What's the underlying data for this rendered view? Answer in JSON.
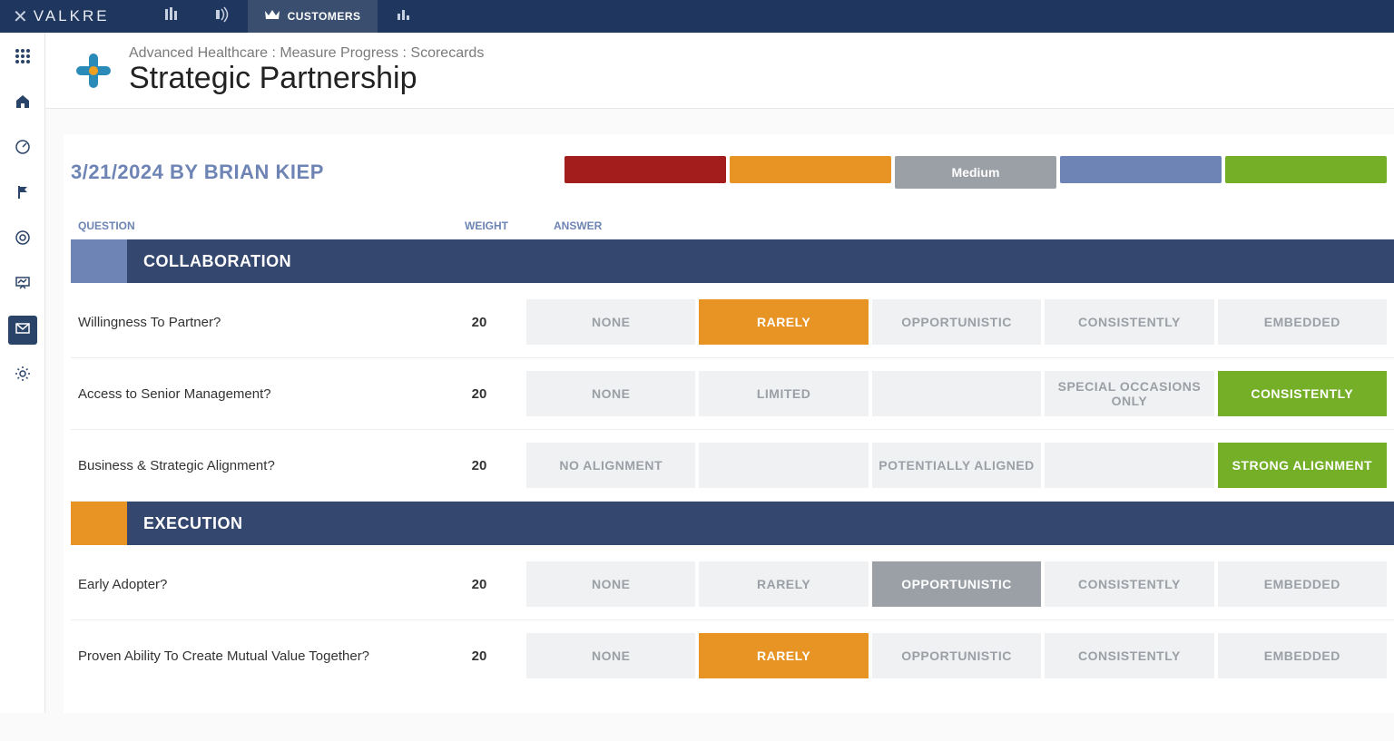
{
  "brand": {
    "name": "VALKRE"
  },
  "topnav": {
    "tabs": [
      {
        "label": "CUSTOMERS"
      }
    ]
  },
  "breadcrumb": {
    "parts": [
      "Advanced Healthcare",
      "Measure Progress",
      "Scorecards"
    ]
  },
  "page": {
    "title": "Strategic Partnership"
  },
  "byline": "3/21/2024 BY BRIAN KIEP",
  "scale": {
    "selected_index": 2,
    "levels": [
      {
        "label": "",
        "color": "c-red"
      },
      {
        "label": "",
        "color": "c-orange"
      },
      {
        "label": "Medium",
        "color": "c-gray"
      },
      {
        "label": "",
        "color": "c-blue"
      },
      {
        "label": "",
        "color": "c-green"
      }
    ]
  },
  "columns": {
    "question": "QUESTION",
    "weight": "WEIGHT",
    "answer": "ANSWER"
  },
  "sections": [
    {
      "name": "COLLABORATION",
      "accent": "#6d84b4",
      "rows": [
        {
          "question": "Willingness To Partner?",
          "weight": "20",
          "selected_index": 1,
          "selected_class": "sel-orange",
          "options": [
            "NONE",
            "RARELY",
            "OPPORTUNISTIC",
            "CONSISTENTLY",
            "EMBEDDED"
          ]
        },
        {
          "question": "Access to Senior Management?",
          "weight": "20",
          "selected_index": 4,
          "selected_class": "sel-green",
          "options": [
            "NONE",
            "LIMITED",
            "",
            "SPECIAL OCCASIONS ONLY",
            "CONSISTENTLY"
          ]
        },
        {
          "question": "Business & Strategic Alignment?",
          "weight": "20",
          "selected_index": 4,
          "selected_class": "sel-green",
          "options": [
            "NO ALIGNMENT",
            "",
            "POTENTIALLY ALIGNED",
            "",
            "STRONG ALIGNMENT"
          ]
        }
      ]
    },
    {
      "name": "EXECUTION",
      "accent": "#e89425",
      "rows": [
        {
          "question": "Early Adopter?",
          "weight": "20",
          "selected_index": 2,
          "selected_class": "sel-gray",
          "options": [
            "NONE",
            "RARELY",
            "OPPORTUNISTIC",
            "CONSISTENTLY",
            "EMBEDDED"
          ]
        },
        {
          "question": "Proven Ability To Create Mutual Value Together?",
          "weight": "20",
          "selected_index": 1,
          "selected_class": "sel-orange",
          "options": [
            "NONE",
            "RARELY",
            "OPPORTUNISTIC",
            "CONSISTENTLY",
            "EMBEDDED"
          ]
        }
      ]
    }
  ]
}
